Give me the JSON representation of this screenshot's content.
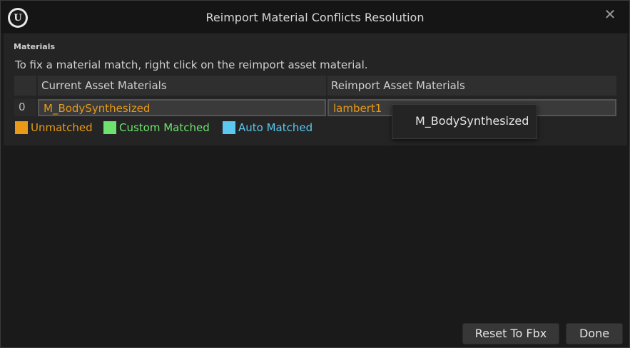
{
  "window": {
    "title": "Reimport Material Conflicts Resolution"
  },
  "titlebar": {
    "logo_text": "U",
    "close_glyph": "✕"
  },
  "materials": {
    "section_label": "Materials",
    "instruction": "To fix a material match, right click on the reimport asset material.",
    "headers": {
      "index": "",
      "current": "Current Asset Materials",
      "reimport": "Reimport Asset Materials"
    },
    "rows": [
      {
        "index": "0",
        "current": "M_BodySynthesized",
        "reimport": "lambert1"
      }
    ]
  },
  "legend": [
    {
      "label": "Unmatched",
      "color": "#e89a18"
    },
    {
      "label": "Custom Matched",
      "color": "#6ee26e"
    },
    {
      "label": "Auto Matched",
      "color": "#5cc8f0"
    }
  ],
  "context_menu": {
    "items": [
      "M_BodySynthesized"
    ]
  },
  "buttons": {
    "reset": "Reset To Fbx",
    "done": "Done"
  }
}
